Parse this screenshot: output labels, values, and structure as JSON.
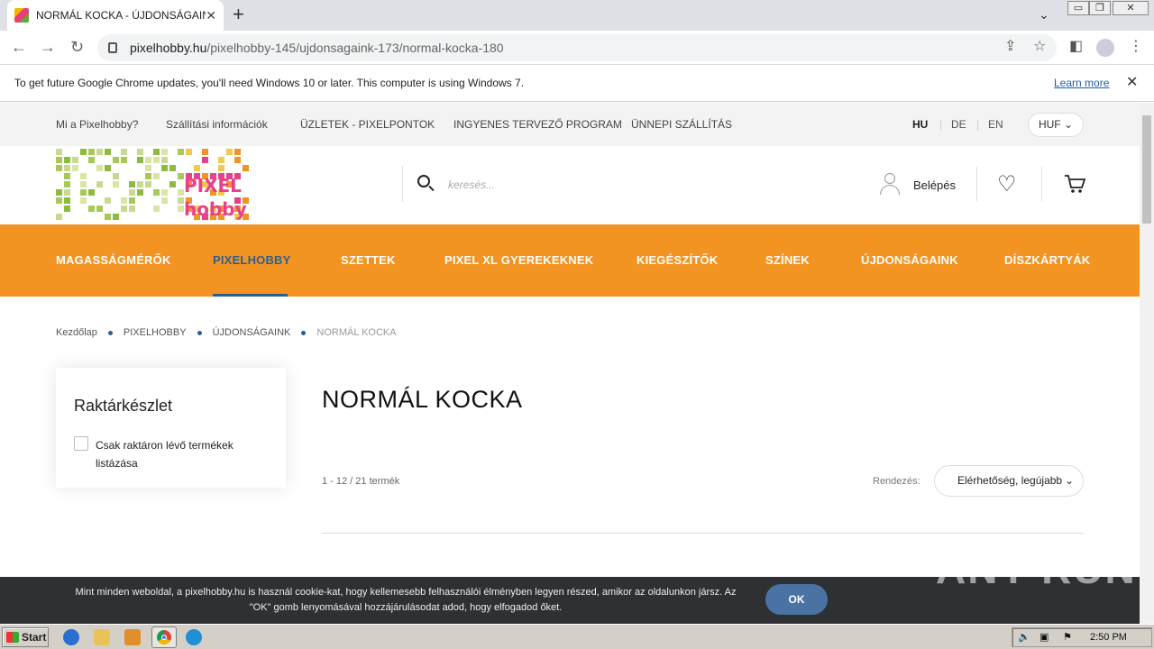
{
  "browser": {
    "tab_title": "NORMÁL KOCKA - ÚJDONSÁGAINK",
    "tab_close": "✕",
    "new_tab": "+",
    "url_host": "pixelhobby.hu",
    "url_path": "/pixelhobby-145/ujdonsagaink-173/normal-kocka-180",
    "window_buttons": [
      "▭",
      "❐",
      "✕"
    ]
  },
  "infobar": {
    "message": "To get future Google Chrome updates, you'll need Windows 10 or later. This computer is using Windows 7.",
    "learn_more": "Learn more",
    "close": "✕"
  },
  "topnav": {
    "links": [
      "Mi a Pixelhobby?",
      "Szállítási információk",
      "ÜZLETEK - PIXELPONTOK",
      "INGYENES TERVEZŐ PROGRAM",
      "ÜNNEPI SZÁLLÍTÁS"
    ],
    "languages": [
      "HU",
      "DE",
      "EN"
    ],
    "active_language": "HU",
    "currency": "HUF"
  },
  "header": {
    "logo_text_top": "PIXEL",
    "logo_text_bottom": "hobby",
    "search_placeholder": "keresés...",
    "login_label": "Belépés"
  },
  "mainmenu": {
    "items": [
      "MAGASSÁGMÉRŐK",
      "PIXELHOBBY",
      "SZETTEK",
      "PIXEL XL GYEREKEKNEK",
      "KIEGÉSZÍTŐK",
      "SZÍNEK",
      "ÚJDONSÁGAINK",
      "DÍSZKÁRTYÁK"
    ],
    "active": "PIXELHOBBY"
  },
  "breadcrumb": [
    "Kezdőlap",
    "PIXELHOBBY",
    "ÚJDONSÁGAINK",
    "NORMÁL KOCKA"
  ],
  "sidebar": {
    "title": "Raktárkészlet",
    "checkbox_label": "Csak raktáron lévő termékek listázása"
  },
  "main": {
    "title": "NORMÁL KOCKA",
    "count": "1 - 12 / 21 termék",
    "sort_label": "Rendezés:",
    "sort_value": "Elérhetőség, legújabb"
  },
  "cookie": {
    "text": "Mint minden weboldal, a pixelhobby.hu is használ cookie-kat, hogy kellemesebb felhasználói élményben legyen részed, amikor az oldalunkon jársz. Az \"OK\" gomb lenyomásával hozzájárulásodat adod, hogy elfogadod őket.",
    "ok": "OK"
  },
  "watermark": "ANY RUN",
  "taskbar": {
    "start": "Start",
    "clock": "2:50 PM"
  },
  "colors": {
    "orange": "#f39321",
    "accent_blue": "#2b5f92"
  }
}
